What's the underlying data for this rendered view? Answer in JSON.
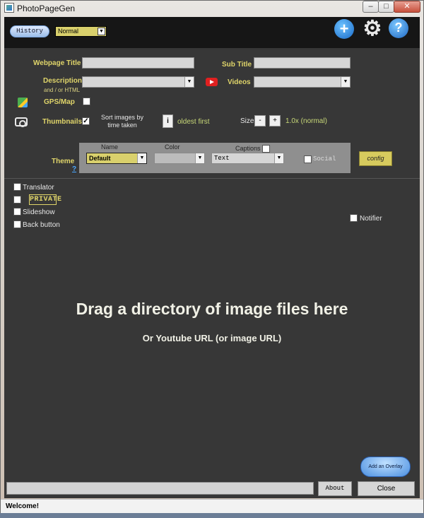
{
  "window": {
    "title": "PhotoPageGen",
    "min": "–",
    "max": "□",
    "close": "✕"
  },
  "topbar": {
    "history_label": "History",
    "mode_value": "Normal",
    "add_icon": "+",
    "gear_icon": "⚙",
    "help_icon": "?"
  },
  "form": {
    "webpage_title_label": "Webpage Title",
    "sub_title_label": "Sub Title",
    "description_label": "Description",
    "description_hint": "and / or HTML",
    "videos_label": "Videos",
    "gps_label": "GPS/Map",
    "thumbnails_label": "Thumbnails",
    "thumbnails_checked": "✓",
    "sort_label": "Sort images by\ntime taken",
    "info_label": "i",
    "oldest_first": "oldest first",
    "size_label": "Size",
    "size_minus": "-",
    "size_plus": "+",
    "size_value": "1.0x (normal)"
  },
  "theme": {
    "label": "Theme",
    "help": "?",
    "name_label": "Name",
    "name_value": "Default",
    "color_label": "Color",
    "captions_label": "Captions",
    "captions_value": "Text",
    "social_label": "Social",
    "config_label": "config"
  },
  "options": {
    "translator": "Translator",
    "private": "PRIVATE",
    "slideshow": "Slideshow",
    "back_button": "Back button",
    "notifier": "Notifier"
  },
  "dropzone": {
    "title": "Drag a directory of image files here",
    "subtitle": "Or Youtube URL (or image URL)"
  },
  "footer": {
    "overlay_label": "Add an Overlay",
    "about_label": "About",
    "close_label": "Close",
    "status": "Welcome!"
  }
}
